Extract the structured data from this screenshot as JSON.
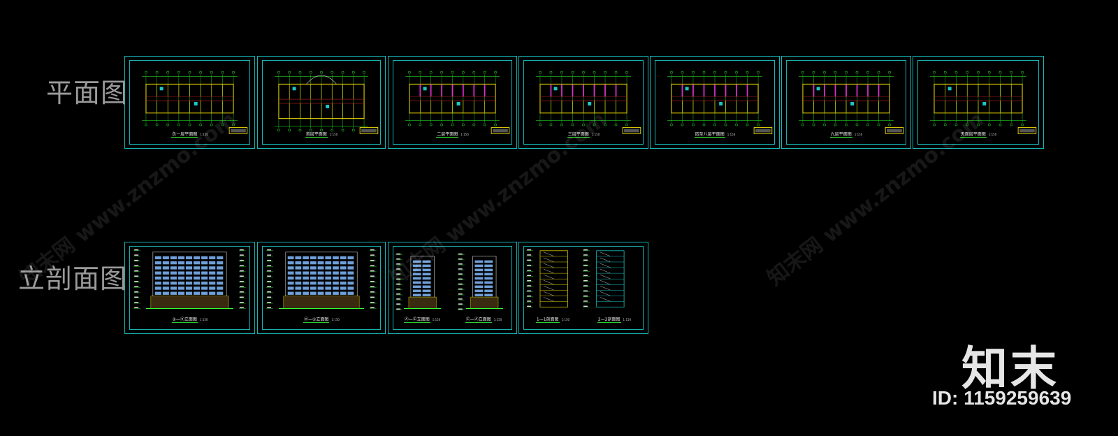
{
  "labels": {
    "plans": "平面图",
    "elevations": "立剖面图"
  },
  "plan_sheets": [
    {
      "title": "负一层平面图",
      "scale": "1:150"
    },
    {
      "title": "首层平面图",
      "scale": "1:150"
    },
    {
      "title": "二层平面图",
      "scale": "1:150"
    },
    {
      "title": "三层平面图",
      "scale": "1:150"
    },
    {
      "title": "四至八层平面图",
      "scale": "1:150"
    },
    {
      "title": "九层平面图",
      "scale": "1:150"
    },
    {
      "title": "天面层平面图",
      "scale": "1:150"
    }
  ],
  "elevation_sheets": [
    {
      "kind": "elevation",
      "titles": [
        {
          "title": "①—⑪立面图",
          "scale": "1:150"
        }
      ]
    },
    {
      "kind": "elevation",
      "titles": [
        {
          "title": "⑪—①立面图",
          "scale": "1:150"
        }
      ]
    },
    {
      "kind": "side",
      "titles": [
        {
          "title": "Ⓐ—Ⓔ立面图",
          "scale": "1:150"
        },
        {
          "title": "Ⓔ—Ⓐ立面图",
          "scale": "1:150"
        }
      ]
    },
    {
      "kind": "section",
      "titles": [
        {
          "title": "1—1剖面图",
          "scale": "1:150"
        },
        {
          "title": "2—2剖面图",
          "scale": "1:150"
        }
      ]
    }
  ],
  "watermark": {
    "text": "知末网 www.znzmo.com",
    "brand": "知末",
    "id": "ID: 1159259639"
  },
  "colors": {
    "frame": "#17b3b3",
    "wall": "#e0d000",
    "grid": "#22cc22",
    "column": "#cc2222",
    "window": "#6f9fd8",
    "accent": "#e020e0"
  }
}
